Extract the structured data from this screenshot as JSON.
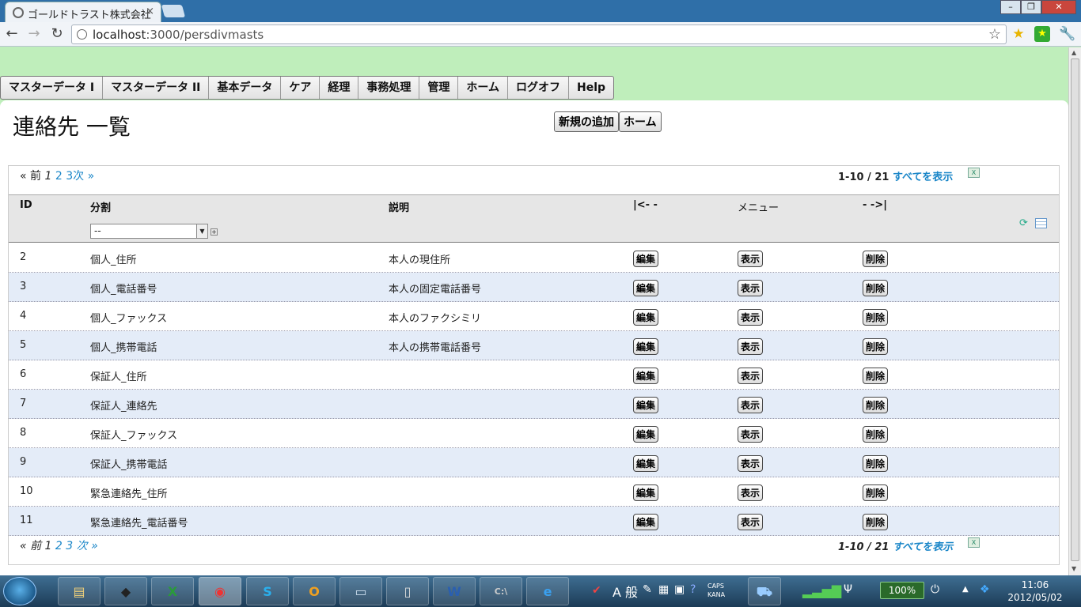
{
  "browser": {
    "tab_title": "ゴールドトラスト株式会社",
    "url_host": "localhost",
    "url_path": ":3000/persdivmasts"
  },
  "menu": [
    {
      "label": "マスターデータ I"
    },
    {
      "label": "マスターデータ II"
    },
    {
      "label": "基本データ"
    },
    {
      "label": "ケア"
    },
    {
      "label": "経理"
    },
    {
      "label": "事務処理"
    },
    {
      "label": "管理"
    },
    {
      "label": "ホーム"
    },
    {
      "label": "ログオフ"
    },
    {
      "label": "Help"
    }
  ],
  "page": {
    "title": "連絡先 一覧",
    "new_button": "新規の追加",
    "home_button": "ホーム"
  },
  "pager": {
    "prev": "« 前",
    "pages": [
      "1",
      "2",
      "3"
    ],
    "next": "次 »",
    "range": "1-10 / 21",
    "show_all": "すべてを表示"
  },
  "table": {
    "headers": {
      "id": "ID",
      "division": "分割",
      "description": "説明",
      "nav_left": "|<- -",
      "menu": "メニュー",
      "nav_right": "- ->|"
    },
    "filter_value": "--",
    "action_labels": {
      "edit": "編集",
      "show": "表示",
      "delete": "削除"
    },
    "rows": [
      {
        "id": "2",
        "division": "個人_住所",
        "description": "本人の現住所"
      },
      {
        "id": "3",
        "division": "個人_電話番号",
        "description": "本人の固定電話番号"
      },
      {
        "id": "4",
        "division": "個人_ファックス",
        "description": "本人のファクシミリ"
      },
      {
        "id": "5",
        "division": "個人_携帯電話",
        "description": "本人の携帯電話番号"
      },
      {
        "id": "6",
        "division": "保証人_住所",
        "description": ""
      },
      {
        "id": "7",
        "division": "保証人_連絡先",
        "description": ""
      },
      {
        "id": "8",
        "division": "保証人_ファックス",
        "description": ""
      },
      {
        "id": "9",
        "division": "保証人_携帯電話",
        "description": ""
      },
      {
        "id": "10",
        "division": "緊急連絡先_住所",
        "description": ""
      },
      {
        "id": "11",
        "division": "緊急連絡先_電話番号",
        "description": ""
      }
    ]
  },
  "taskbar": {
    "battery": "100%",
    "caps": "CAPS",
    "kana": "KANA",
    "ime_label": "A 般",
    "time": "11:06",
    "date": "2012/05/02"
  },
  "colors": {
    "page_background": "#bfeebb",
    "link": "#1a86c8",
    "alt_row": "#e4ecf8"
  }
}
